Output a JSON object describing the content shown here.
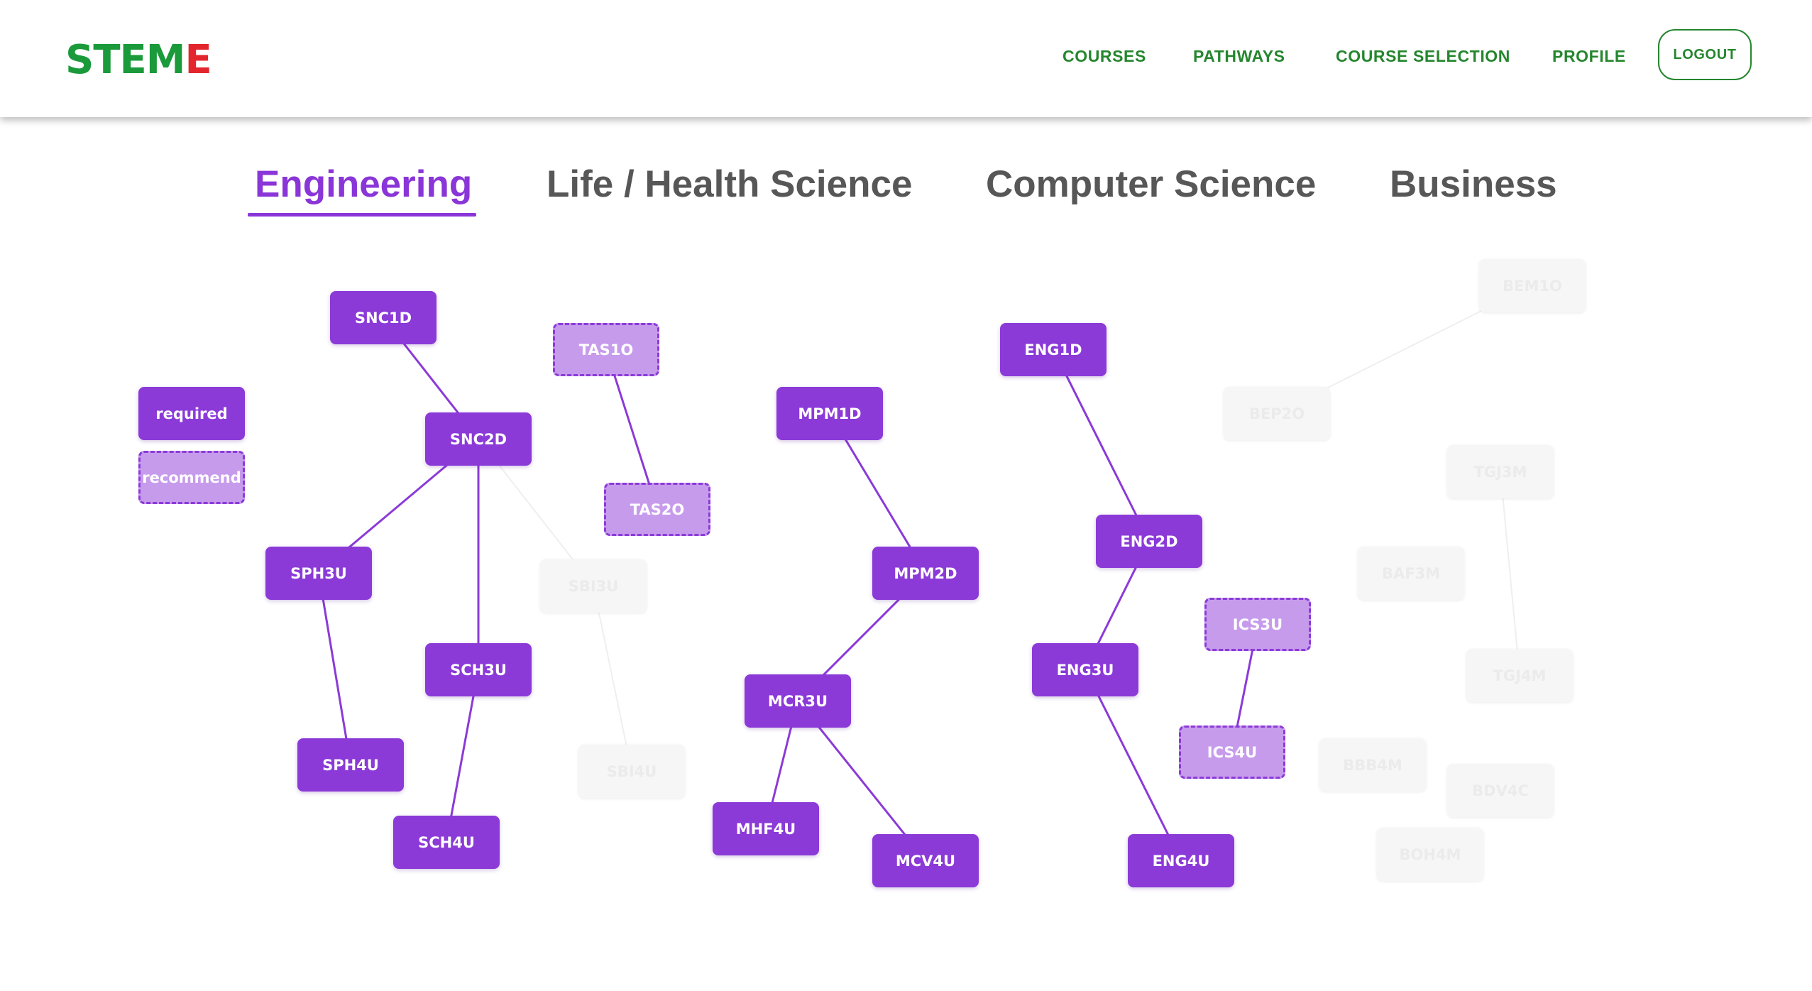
{
  "brand": {
    "logo_left": "STEM",
    "logo_right": "E"
  },
  "nav": {
    "courses": "COURSES",
    "pathways": "PATHWAYS",
    "course_selection": "COURSE SELECTION",
    "profile": "PROFILE",
    "logout": "LOGOUT"
  },
  "tabs": [
    {
      "label": "Engineering",
      "active": true
    },
    {
      "label": "Life / Health Science",
      "active": false
    },
    {
      "label": "Computer Science",
      "active": false
    },
    {
      "label": "Business",
      "active": false
    }
  ],
  "legend": {
    "required": "required",
    "recommend": "recommend"
  },
  "colors": {
    "brand_green": "#25862e",
    "logo_red": "#e3262d",
    "accent_purple": "#8a35d8",
    "recommend_fill": "#c79bec"
  },
  "courses": {
    "SNC1D": {
      "label": "SNC1D",
      "status": "required"
    },
    "SNC2D": {
      "label": "SNC2D",
      "status": "required"
    },
    "TAS1O": {
      "label": "TAS1O",
      "status": "recommend"
    },
    "TAS2O": {
      "label": "TAS2O",
      "status": "recommend"
    },
    "SPH3U": {
      "label": "SPH3U",
      "status": "required"
    },
    "SCH3U": {
      "label": "SCH3U",
      "status": "required"
    },
    "SPH4U": {
      "label": "SPH4U",
      "status": "required"
    },
    "SCH4U": {
      "label": "SCH4U",
      "status": "required"
    },
    "SBI3U": {
      "label": "SBI3U",
      "status": "inactive"
    },
    "SBI4U": {
      "label": "SBI4U",
      "status": "inactive"
    },
    "MPM1D": {
      "label": "MPM1D",
      "status": "required"
    },
    "MPM2D": {
      "label": "MPM2D",
      "status": "required"
    },
    "MCR3U": {
      "label": "MCR3U",
      "status": "required"
    },
    "MHF4U": {
      "label": "MHF4U",
      "status": "required"
    },
    "MCV4U": {
      "label": "MCV4U",
      "status": "required"
    },
    "ENG1D": {
      "label": "ENG1D",
      "status": "required"
    },
    "ENG2D": {
      "label": "ENG2D",
      "status": "required"
    },
    "ENG3U": {
      "label": "ENG3U",
      "status": "required"
    },
    "ENG4U": {
      "label": "ENG4U",
      "status": "required"
    },
    "ICS3U": {
      "label": "ICS3U",
      "status": "recommend"
    },
    "ICS4U": {
      "label": "ICS4U",
      "status": "recommend"
    },
    "BEM1O": {
      "label": "BEM1O",
      "status": "inactive"
    },
    "BEP2O": {
      "label": "BEP2O",
      "status": "inactive"
    },
    "TGJ3M": {
      "label": "TGJ3M",
      "status": "inactive"
    },
    "BAF3M": {
      "label": "BAF3M",
      "status": "inactive"
    },
    "TGJ4M": {
      "label": "TGJ4M",
      "status": "inactive"
    },
    "BBB4M": {
      "label": "BBB4M",
      "status": "inactive"
    },
    "BDV4C": {
      "label": "BDV4C",
      "status": "inactive"
    },
    "BOH4M": {
      "label": "BOH4M",
      "status": "inactive"
    }
  },
  "prerequisites": [
    {
      "from": "SNC1D",
      "to": "SNC2D",
      "status": "required"
    },
    {
      "from": "SNC2D",
      "to": "SPH3U",
      "status": "required"
    },
    {
      "from": "SNC2D",
      "to": "SCH3U",
      "status": "required"
    },
    {
      "from": "SNC2D",
      "to": "SBI3U",
      "status": "inactive"
    },
    {
      "from": "SPH3U",
      "to": "SPH4U",
      "status": "required"
    },
    {
      "from": "SCH3U",
      "to": "SCH4U",
      "status": "required"
    },
    {
      "from": "SBI3U",
      "to": "SBI4U",
      "status": "inactive"
    },
    {
      "from": "TAS1O",
      "to": "TAS2O",
      "status": "required"
    },
    {
      "from": "MPM1D",
      "to": "MPM2D",
      "status": "required"
    },
    {
      "from": "MPM2D",
      "to": "MCR3U",
      "status": "required"
    },
    {
      "from": "MCR3U",
      "to": "MHF4U",
      "status": "required"
    },
    {
      "from": "MCR3U",
      "to": "MCV4U",
      "status": "required"
    },
    {
      "from": "ENG1D",
      "to": "ENG2D",
      "status": "required"
    },
    {
      "from": "ENG2D",
      "to": "ENG3U",
      "status": "required"
    },
    {
      "from": "ENG3U",
      "to": "ENG4U",
      "status": "required"
    },
    {
      "from": "ICS3U",
      "to": "ICS4U",
      "status": "required"
    },
    {
      "from": "BEM1O",
      "to": "BEP2O",
      "status": "inactive"
    },
    {
      "from": "TGJ3M",
      "to": "TGJ4M",
      "status": "inactive"
    }
  ]
}
